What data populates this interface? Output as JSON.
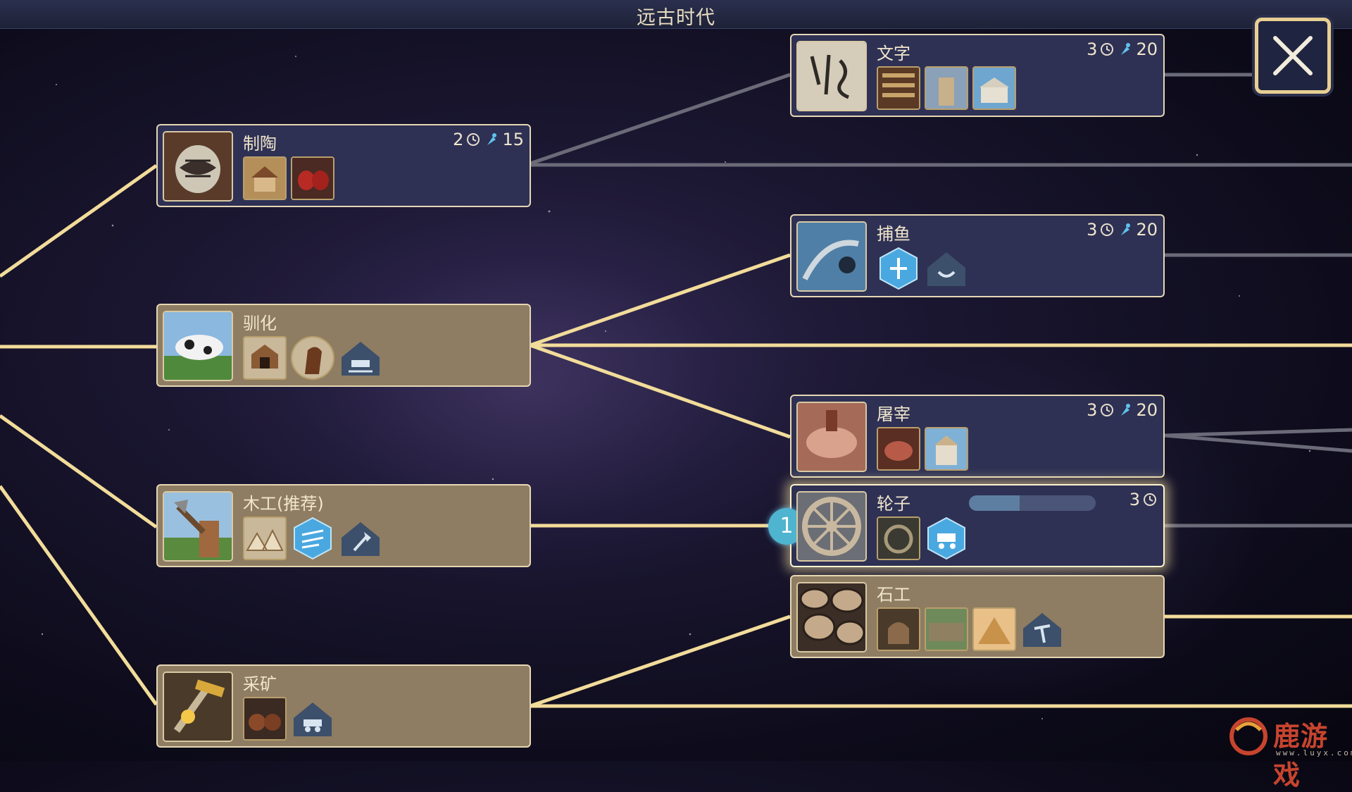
{
  "header": {
    "era_title": "远古时代"
  },
  "close_button": {
    "icon": "close-icon"
  },
  "colors": {
    "line_active": "#f2dc9a",
    "line_inactive": "#6b6a78",
    "node_dark": "#2e3154",
    "node_light": "#8e7d62",
    "border": "#e6d7b4"
  },
  "nodes": {
    "pottery": {
      "title": "制陶",
      "turns": "2",
      "science": "15",
      "unlocks": [
        "granary-building-icon",
        "red-pottery-icon"
      ]
    },
    "writing": {
      "title": "文字",
      "turns": "3",
      "science": "20",
      "unlocks": [
        "library-icon",
        "temple-icon",
        "great-library-icon"
      ]
    },
    "fishing": {
      "title": "捕鱼",
      "turns": "3",
      "science": "20",
      "unlocks": [
        "fishing-boat-hex-icon",
        "fishing-house-icon"
      ]
    },
    "domestication": {
      "title": "驯化",
      "unlocks": [
        "kennel-icon",
        "horse-icon",
        "pasture-house-icon"
      ]
    },
    "butchery": {
      "title": "屠宰",
      "turns": "3",
      "science": "20",
      "unlocks": [
        "meat-icon",
        "temple-wonder-icon"
      ]
    },
    "carpentry": {
      "title": "木工(推荐)",
      "unlocks": [
        "tents-icon",
        "lumber-hex-icon",
        "axe-house-icon"
      ]
    },
    "wheel": {
      "title": "轮子",
      "turns": "3",
      "queue": "1",
      "progress": 0.4,
      "unlocks": [
        "water-mill-icon",
        "cart-hex-icon"
      ]
    },
    "masonry": {
      "title": "石工",
      "unlocks": [
        "kiln-icon",
        "wall-icon",
        "pyramid-icon",
        "quarry-house-icon"
      ]
    },
    "mining": {
      "title": "采矿",
      "unlocks": [
        "ore-sacks-icon",
        "mine-cart-house-icon"
      ]
    }
  },
  "watermark": {
    "text": "鹿游戏",
    "url": "www.luyx.com"
  }
}
